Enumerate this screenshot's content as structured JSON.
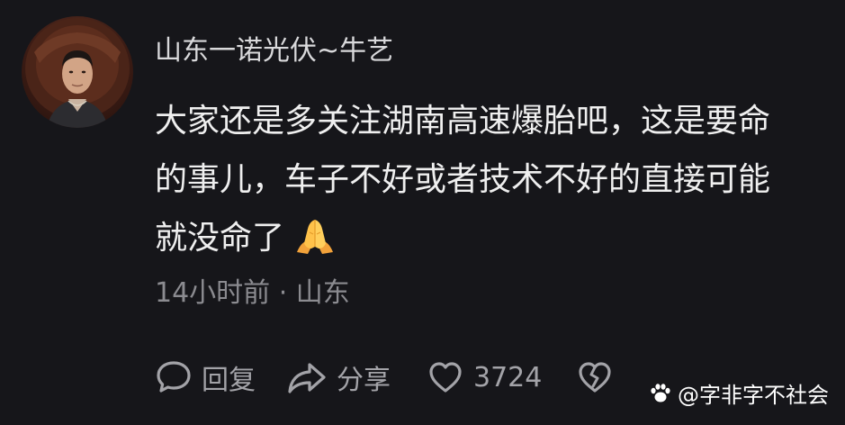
{
  "comment": {
    "username": "山东一诺光伏~牛艺",
    "body_lines": [
      "大家还是多关注湖南高速爆胎吧，这是要命",
      "的事儿，车子不好或者技术不好的直接可能",
      "就没命了"
    ],
    "emoji": "pray-hands-emoji",
    "meta": "14小时前 · 山东",
    "actions": {
      "reply_label": "回复",
      "share_label": "分享",
      "like_count": "3724"
    }
  },
  "watermark": {
    "text": "@字非字不社会"
  },
  "icons": {
    "reply": "speech-bubble-icon",
    "share": "share-arrow-icon",
    "like": "heart-icon",
    "dislike": "broken-heart-icon",
    "watermark": "paw-icon"
  },
  "colors": {
    "background": "#16161a",
    "text_primary": "#efefef",
    "text_secondary": "#8b8b90",
    "icon": "#a3a3a8"
  }
}
